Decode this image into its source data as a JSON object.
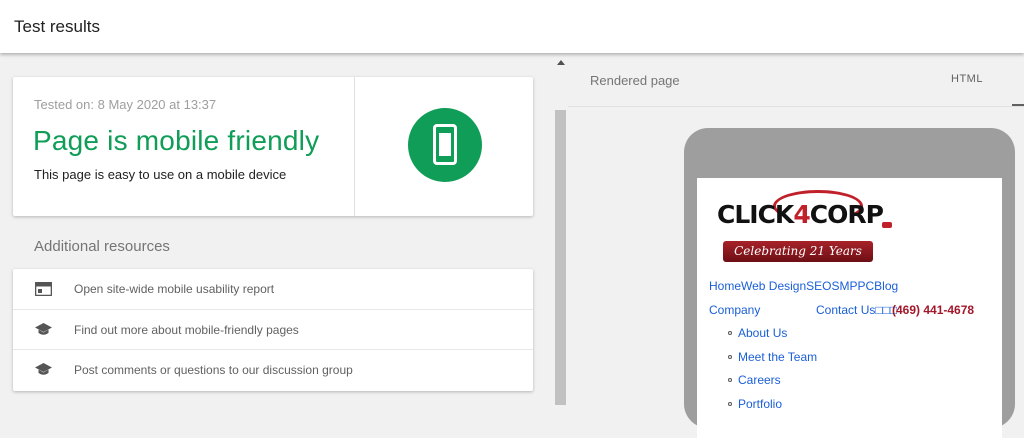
{
  "header": {
    "title": "Test results"
  },
  "result": {
    "tested_on": "Tested on: 8 May 2020 at 13:37",
    "verdict": "Page is mobile friendly",
    "description": "This page is easy to use on a mobile device",
    "accent": "#0f9d58"
  },
  "resources": {
    "title": "Additional resources",
    "items": [
      {
        "icon": "report-window-icon",
        "label": "Open site-wide mobile usability report"
      },
      {
        "icon": "school-cap-icon",
        "label": "Find out more about mobile-friendly pages"
      },
      {
        "icon": "school-cap-icon",
        "label": "Post comments or questions to our discussion group"
      }
    ]
  },
  "preview": {
    "tab_rendered": "Rendered page",
    "tab_html": "HTML",
    "site": {
      "logo_text_a": "CLICK",
      "logo_text_b": "4",
      "logo_text_c": "CORP",
      "banner": "Celebrating 21 Years",
      "nav_row1": "HomeWeb DesignSEOSMPPCBlog",
      "company": "Company",
      "contact": "Contact Us□□□",
      "phone": "(469) 441-4678",
      "submenu": [
        "About Us",
        "Meet the Team",
        "Careers",
        "Portfolio"
      ]
    }
  }
}
